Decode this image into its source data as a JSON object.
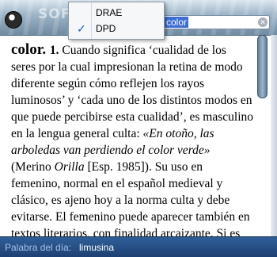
{
  "watermark_text": "SOFTPEDIA",
  "menu": {
    "items": [
      {
        "label": "DRAE",
        "checked": false
      },
      {
        "label": "DPD",
        "checked": true
      }
    ]
  },
  "search": {
    "value": "color"
  },
  "entry": {
    "headword": "color",
    "sense_number": "1.",
    "part1": "Cuando significa ‘cualidad de los seres por la cual impresionan la retina de modo diferente según cómo reflejen los rayos luminosos’ y ‘cada uno de los distintos modos en que puede percibirse esta cualidad’, es masculino en la lengua general culta: ",
    "example": "«En otoño, las arboledas van perdiendo el color verde»",
    "part2": " (Merino ",
    "source_italic": "Orilla",
    "part3": " [Esp. 1985]). Su uso en femenino, normal en el español medieval y clásico, es ajeno hoy a la norma culta y debe evitarse. El femenino puede aparecer también en textos literarios, con finalidad arcaizante. Si es"
  },
  "footer": {
    "label": "Palabra del día:",
    "word": "limusina"
  }
}
